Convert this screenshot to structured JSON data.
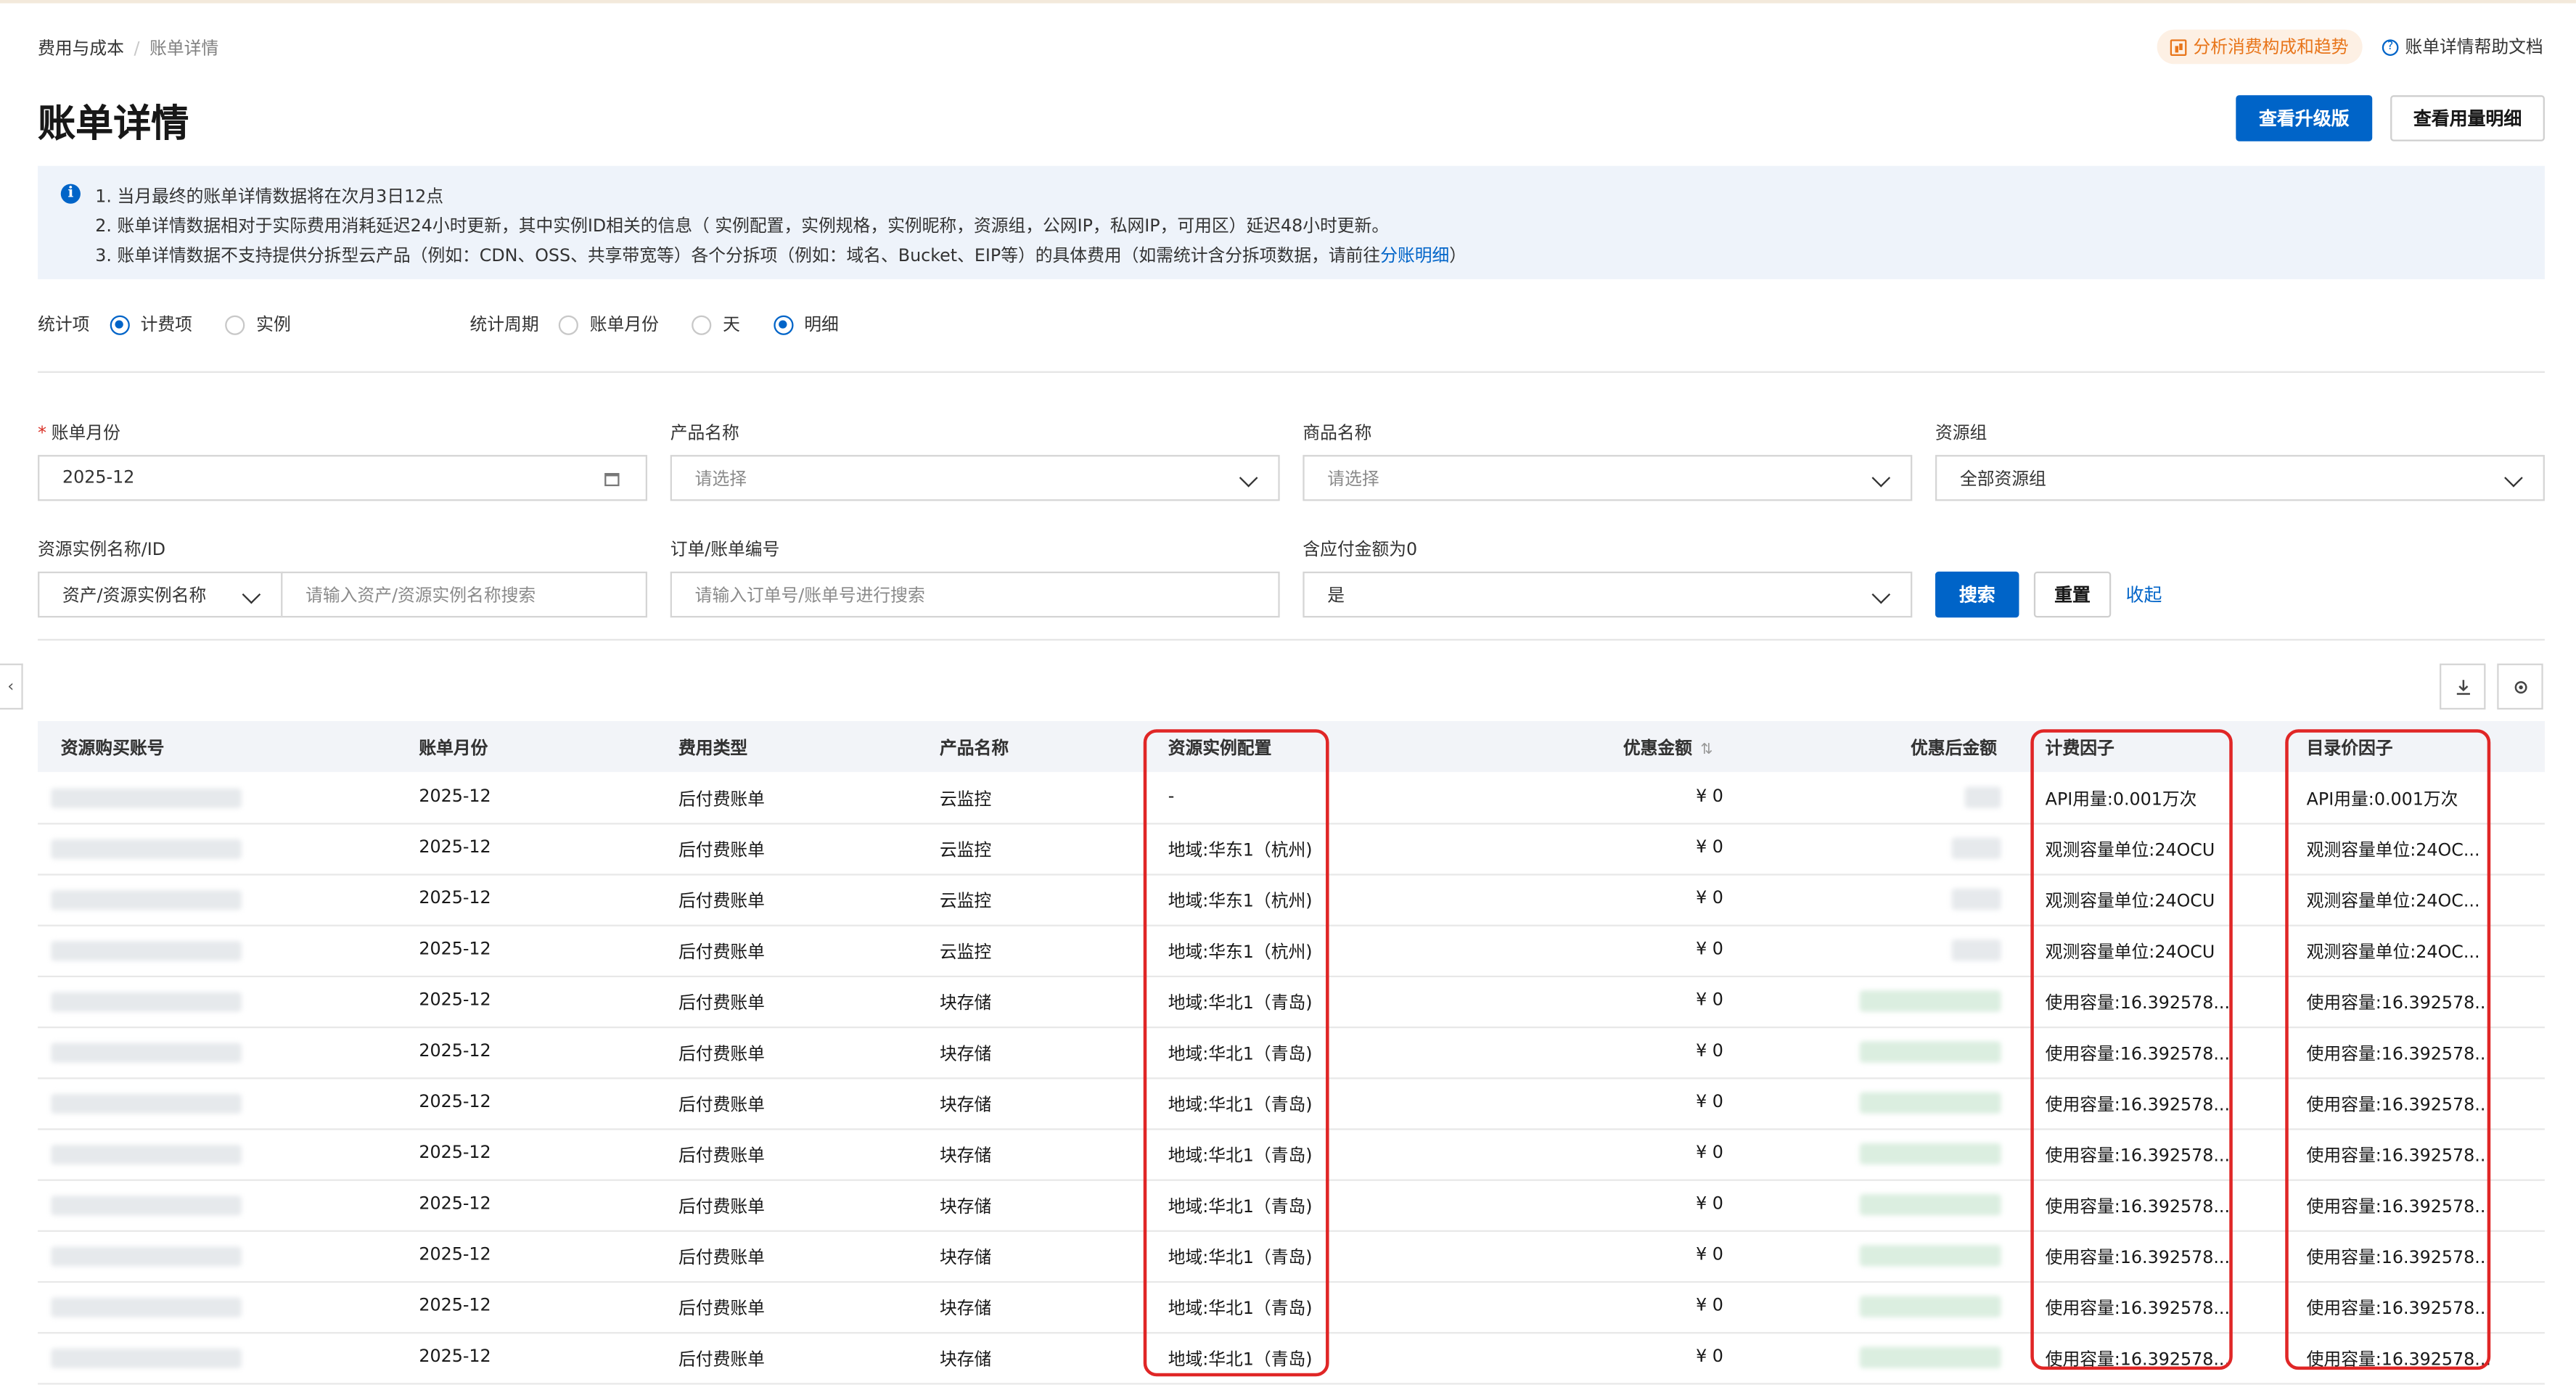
{
  "breadcrumb": {
    "parent": "费用与成本",
    "separator": "/",
    "current": "账单详情"
  },
  "page": {
    "title": "账单详情"
  },
  "header": {
    "analyze_link": "分析消费构成和趋势",
    "help_link": "账单详情帮助文档",
    "upgrade_button": "查看升级版",
    "usage_button": "查看用量明细"
  },
  "notice": {
    "line1": "1. 当月最终的账单详情数据将在次月3日12点",
    "line2": "2. 账单详情数据相对于实际费用消耗延迟24小时更新，其中实例ID相关的信息（ 实例配置，实例规格，实例昵称，资源组，公网IP，私网IP，可用区）延迟48小时更新。",
    "line3_prefix": "3. 账单详情数据不支持提供分拆型云产品（例如：CDN、OSS、共享带宽等）各个分拆项（例如：域名、Bucket、EIP等）的具体费用（如需统计含分拆项数据，请前往",
    "line3_link": "分账明细",
    "line3_suffix": "）"
  },
  "stats_item": {
    "label": "统计项",
    "options": [
      {
        "label": "计费项",
        "selected": true
      },
      {
        "label": "实例",
        "selected": false
      }
    ]
  },
  "stats_period": {
    "label": "统计周期",
    "options": [
      {
        "label": "账单月份",
        "selected": false
      },
      {
        "label": "天",
        "selected": false
      },
      {
        "label": "明细",
        "selected": true
      }
    ]
  },
  "filters": {
    "bill_month": {
      "label": "账单月份",
      "value": "2025-12"
    },
    "product_name": {
      "label": "产品名称",
      "placeholder": "请选择"
    },
    "commodity_name": {
      "label": "商品名称",
      "placeholder": "请选择"
    },
    "resource_group": {
      "label": "资源组",
      "value": "全部资源组"
    },
    "instance": {
      "label": "资源实例名称/ID",
      "type_value": "资产/资源实例名称",
      "placeholder": "请输入资产/资源实例名称搜索"
    },
    "order": {
      "label": "订单/账单编号",
      "placeholder": "请输入订单号/账单号进行搜索"
    },
    "zero_amount": {
      "label": "含应付金额为0",
      "value": "是"
    },
    "search_button": "搜索",
    "reset_button": "重置",
    "collapse_link": "收起"
  },
  "table": {
    "columns": {
      "account": "资源购买账号",
      "month": "账单月份",
      "fee_type": "费用类型",
      "product": "产品名称",
      "config": "资源实例配置",
      "discount": "优惠金额",
      "after_discount": "优惠后金额",
      "billing_factor": "计费因子",
      "list_price_factor": "目录价因子"
    },
    "rows": [
      {
        "month": "2025-12",
        "fee_type": "后付费账单",
        "product": "云监控",
        "config": "-",
        "discount": "¥ 0",
        "billing_factor": "API用量:0.001万次",
        "list_price_factor": "API用量:0.001万次"
      },
      {
        "month": "2025-12",
        "fee_type": "后付费账单",
        "product": "云监控",
        "config": "地域:华东1（杭州)",
        "discount": "¥ 0",
        "billing_factor": "观测容量单位:24OCU",
        "list_price_factor": "观测容量单位:24OC..."
      },
      {
        "month": "2025-12",
        "fee_type": "后付费账单",
        "product": "云监控",
        "config": "地域:华东1（杭州)",
        "discount": "¥ 0",
        "billing_factor": "观测容量单位:24OCU",
        "list_price_factor": "观测容量单位:24OC..."
      },
      {
        "month": "2025-12",
        "fee_type": "后付费账单",
        "product": "云监控",
        "config": "地域:华东1（杭州)",
        "discount": "¥ 0",
        "billing_factor": "观测容量单位:24OCU",
        "list_price_factor": "观测容量单位:24OC..."
      },
      {
        "month": "2025-12",
        "fee_type": "后付费账单",
        "product": "块存储",
        "config": "地域:华北1（青岛)",
        "discount": "¥ 0",
        "billing_factor": "使用容量:16.392578...",
        "list_price_factor": "使用容量:16.392578..."
      },
      {
        "month": "2025-12",
        "fee_type": "后付费账单",
        "product": "块存储",
        "config": "地域:华北1（青岛)",
        "discount": "¥ 0",
        "billing_factor": "使用容量:16.392578...",
        "list_price_factor": "使用容量:16.392578..."
      },
      {
        "month": "2025-12",
        "fee_type": "后付费账单",
        "product": "块存储",
        "config": "地域:华北1（青岛)",
        "discount": "¥ 0",
        "billing_factor": "使用容量:16.392578...",
        "list_price_factor": "使用容量:16.392578..."
      },
      {
        "month": "2025-12",
        "fee_type": "后付费账单",
        "product": "块存储",
        "config": "地域:华北1（青岛)",
        "discount": "¥ 0",
        "billing_factor": "使用容量:16.392578...",
        "list_price_factor": "使用容量:16.392578..."
      },
      {
        "month": "2025-12",
        "fee_type": "后付费账单",
        "product": "块存储",
        "config": "地域:华北1（青岛)",
        "discount": "¥ 0",
        "billing_factor": "使用容量:16.392578...",
        "list_price_factor": "使用容量:16.392578..."
      },
      {
        "month": "2025-12",
        "fee_type": "后付费账单",
        "product": "块存储",
        "config": "地域:华北1（青岛)",
        "discount": "¥ 0",
        "billing_factor": "使用容量:16.392578...",
        "list_price_factor": "使用容量:16.392578..."
      },
      {
        "month": "2025-12",
        "fee_type": "后付费账单",
        "product": "块存储",
        "config": "地域:华北1（青岛)",
        "discount": "¥ 0",
        "billing_factor": "使用容量:16.392578...",
        "list_price_factor": "使用容量:16.392578..."
      },
      {
        "month": "2025-12",
        "fee_type": "后付费账单",
        "product": "块存储",
        "config": "地域:华北1（青岛)",
        "discount": "¥ 0",
        "billing_factor": "使用容量:16.392578...",
        "list_price_factor": "使用容量:16.392578..."
      }
    ]
  },
  "colors": {
    "primary": "#0064c8",
    "highlight": "#e02626",
    "accent_orange": "#e8751a",
    "notice_bg": "#eef3fa"
  },
  "icons": {
    "analyze": "bar-chart-icon",
    "help": "question-circle-icon",
    "info": "info-icon",
    "calendar": "calendar-icon",
    "download": "download-icon",
    "settings": "gear-icon",
    "sort": "sort-icon",
    "side": "chevron-left-icon"
  }
}
